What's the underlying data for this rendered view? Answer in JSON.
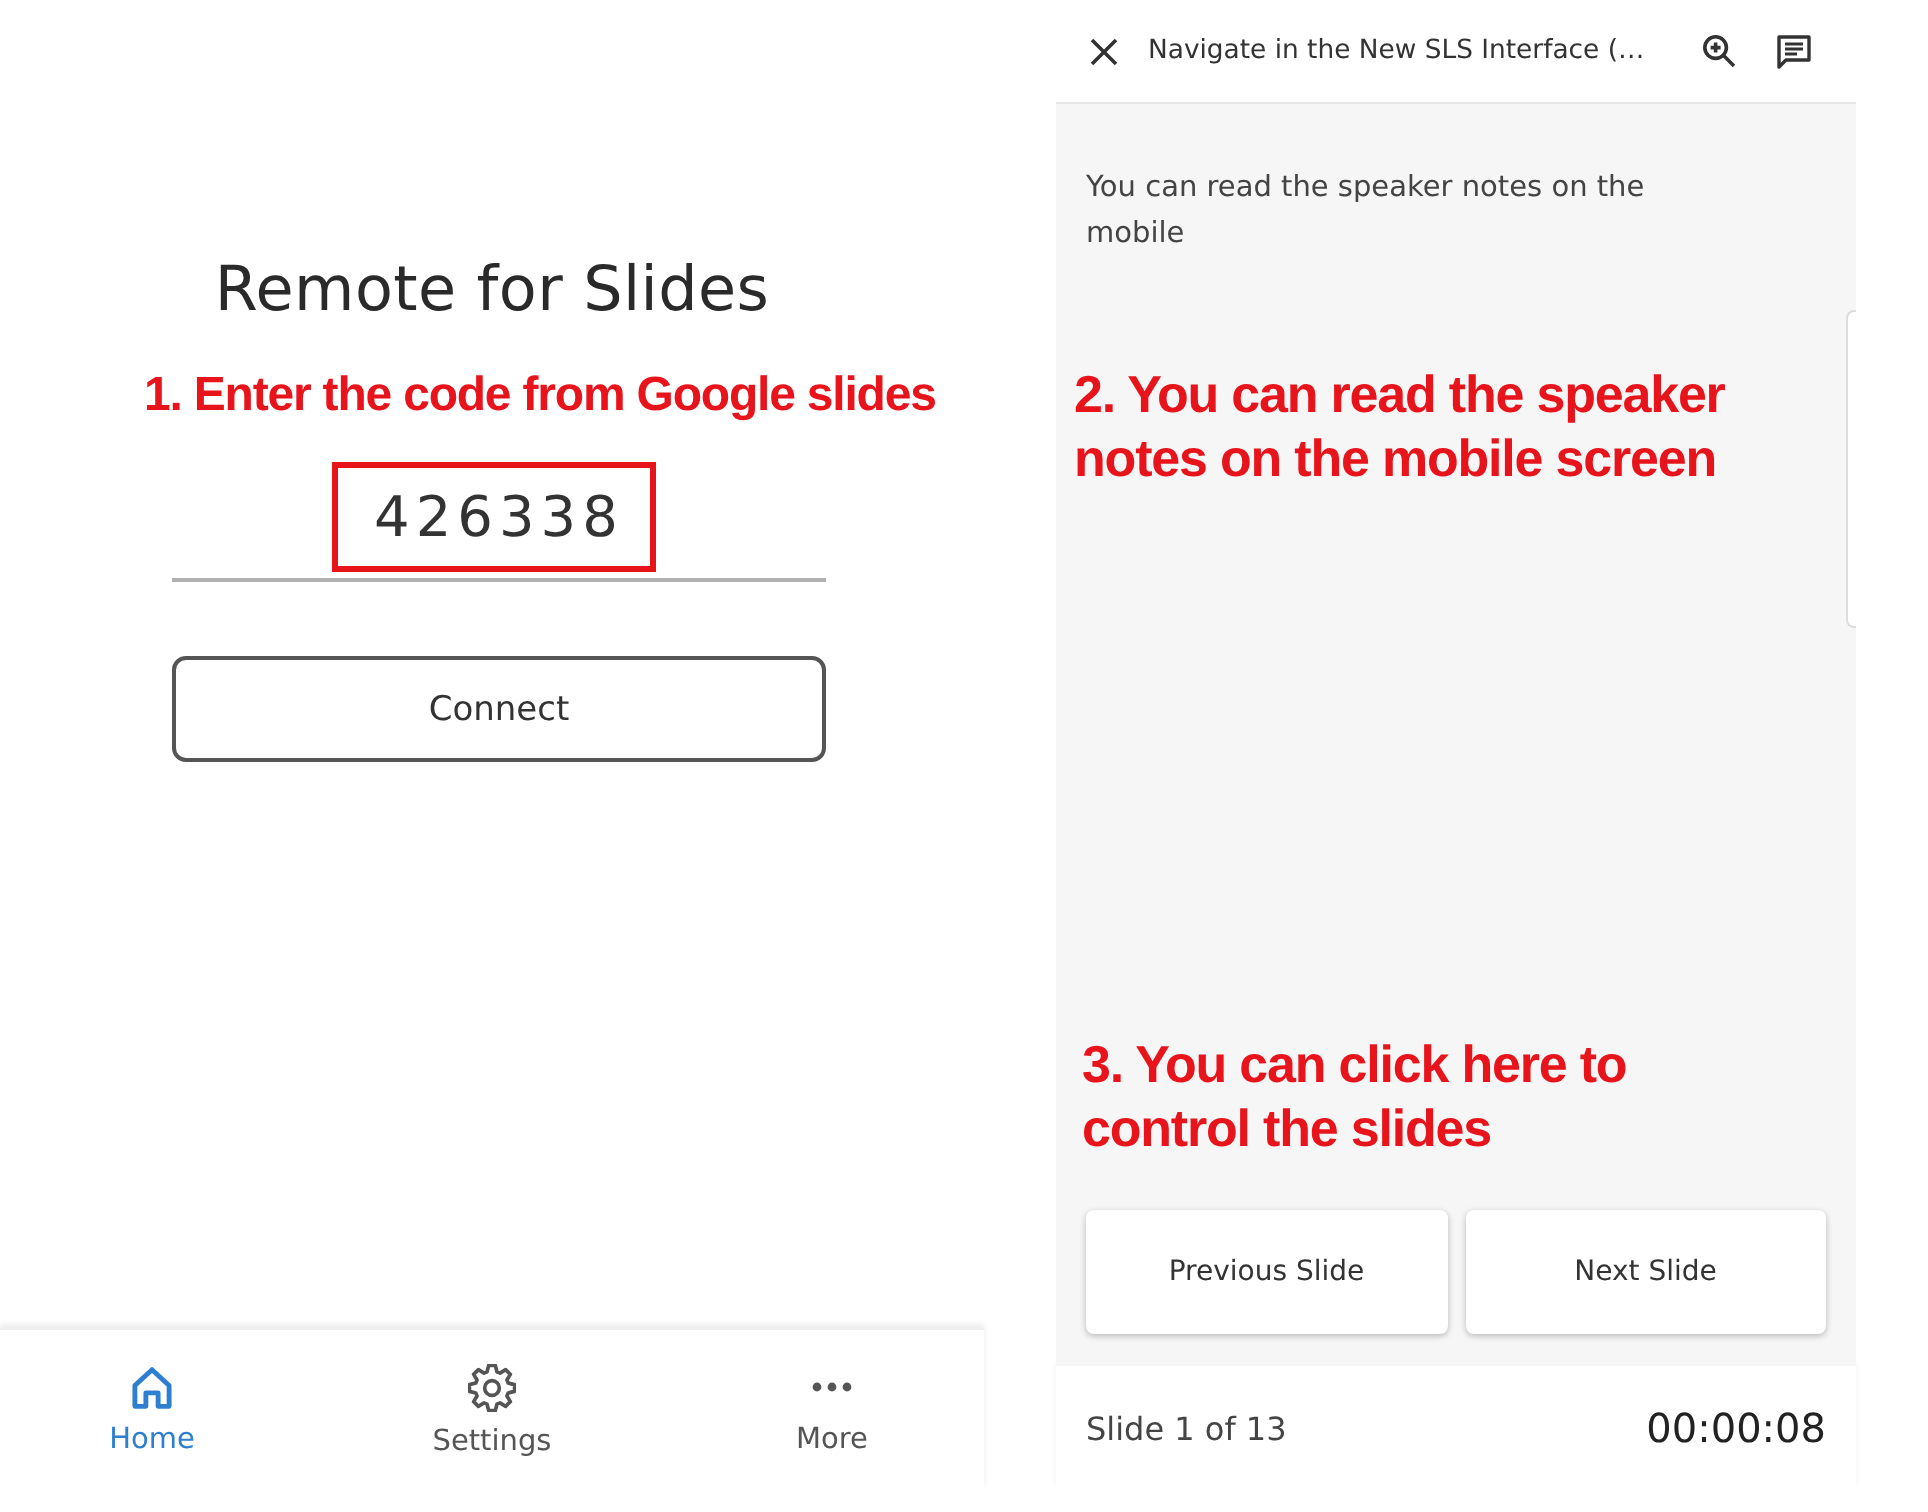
{
  "left_screen": {
    "title": "Remote for Slides",
    "annotation": "1. Enter the code from Google slides",
    "code_field": {
      "value": "426338",
      "highlighted": true
    },
    "connect_button": "Connect",
    "bottom_nav": [
      {
        "label": "Home",
        "selected": true
      },
      {
        "label": "Settings",
        "selected": false
      },
      {
        "label": "More",
        "selected": false
      }
    ]
  },
  "right_screen": {
    "header": {
      "title": "Navigate in the New SLS Interface (…"
    },
    "speaker_notes": "You can read the speaker notes on the mobile",
    "annotations": [
      "2. You can read the speaker notes on the mobile screen",
      "3. You can click here to control the slides"
    ],
    "buttons": [
      "Previous Slide",
      "Next Slide"
    ],
    "footer": {
      "slide_counter": "Slide 1 of 13",
      "timer": "00:00:08"
    }
  }
}
